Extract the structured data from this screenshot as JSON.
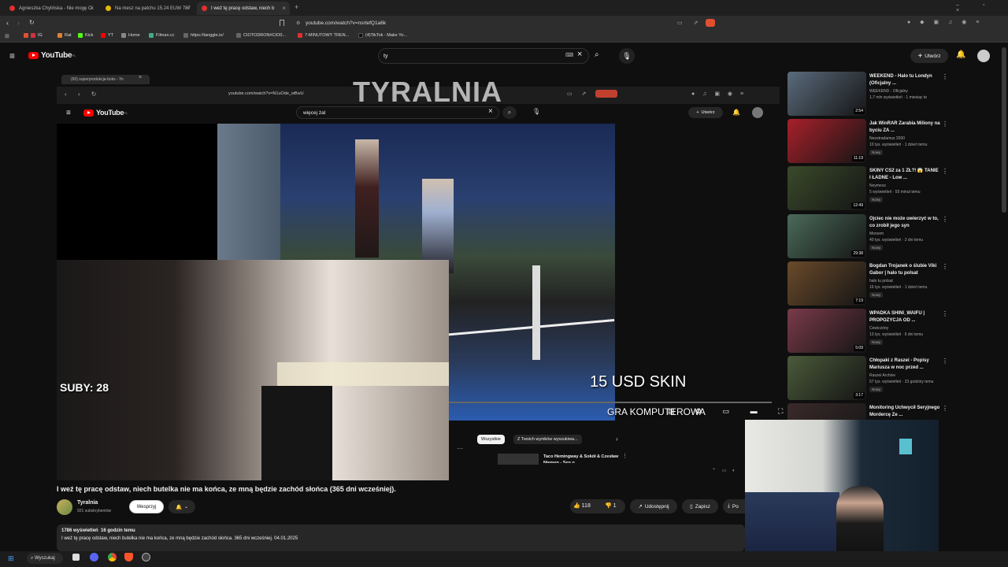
{
  "tabs": [
    {
      "label": "Agnieszka Chylińska - Nie mogę Ci"
    },
    {
      "label": "Na mesz na patchu 15.24 EUW 787"
    },
    {
      "label": "I weź tę pracę odstaw, niech b"
    }
  ],
  "address": {
    "url": "youtube.com/watch?v=nsrtefQ1a6k"
  },
  "bookmarks": [
    "IG",
    "Rat",
    "Kick",
    "YT",
    "Home",
    "Filman.cc",
    "https://tanggle.io/",
    "CIOTODRON#CIO0...",
    "7-MINUTOWY TREN...",
    "(4)TikTok - Make Yo..."
  ],
  "header": {
    "logo": "YouTube",
    "region": "PL",
    "search_value": "ty",
    "create_label": "Utwórz"
  },
  "inner": {
    "tab_label": "(60) superprodukcja-boks - Yo",
    "url": "youtube.com/watch?v=N1uOde_wBwU",
    "logo": "YouTube",
    "region": "PL",
    "search_value": "więcej żal",
    "create_label": "Utwórz",
    "chip_all": "Wszystkie",
    "chip_search": "Z Twoich wyników wyszukiwa...",
    "rec_title": "Taco Hemingway & Sokół & Czesław Niemen - Sen o..."
  },
  "overlay": {
    "channel_title": "TYRALNIA",
    "subs": "SUBY: 28",
    "skin": "15 USD SKIN",
    "gra": "GRA KOMPUTEROWA"
  },
  "video": {
    "title": "I weź tę pracę odstaw, niech butelka nie ma końca, ze mną będzie zachód słońca (365 dni wcześniej).",
    "channel": "Tyralnia",
    "subscribers": "921 subskrybentów",
    "support": "Wesprzyj",
    "likes": "118",
    "dislikes": "1",
    "share": "Udostępnij",
    "save": "Zapisz",
    "download": "Po",
    "views": "1786 wyświetleń",
    "ago": "16 godzin temu",
    "description": "I weź tę pracę odstaw, niech butelka nie ma końca, ze mną będzie zachód słońca. 365 dni wcześniej. 04.01.2025"
  },
  "recommendations": [
    {
      "title": "WEEKEND - Halo tu Londyn (Oficjalny ...",
      "channel": "WEEKEND - Oficjalny",
      "meta": "1,7 mln wyświetleń · 1 miesiąc te",
      "badge": "",
      "duration": "2:54",
      "color": "#5a6b7c"
    },
    {
      "title": "Jak WinRAR Zarabia Miliony na byciu ZA ...",
      "channel": "Neostradamus 2000",
      "meta": "10 tys. wyświetleń · 1 dzień temu",
      "badge": "Nowy",
      "duration": "11:19",
      "color": "#a8202a"
    },
    {
      "title": "SKINY CS2 za 1 ZŁ?! 😱 TANIE I ŁADNE - Low ...",
      "channel": "Neymess",
      "meta": "5 wyświetleń · 55 minut temu",
      "badge": "Nowy",
      "duration": "12:49",
      "color": "#3a4a2a"
    },
    {
      "title": "Ojciec nie może uwierzyć w to, co zrobił jego syn",
      "channel": "Morsem",
      "meta": "40 tys. wyświetleń · 2 dni temu",
      "badge": "Nowy",
      "duration": "29:38",
      "color": "#4a6a5a"
    },
    {
      "title": "Bogdan Trojanek o ślubie Viki Gabor | halo tu polsat",
      "channel": "halo tu polsat",
      "meta": "16 tys. wyświetleń · 1 dzień temu",
      "badge": "Nowy",
      "duration": "7:19",
      "color": "#6a4a2a"
    },
    {
      "title": "WPADKA SHINI_WAIFU | PROPOZYCJA OD ...",
      "channel": "Cewiczóny",
      "meta": "13 tys. wyświetleń · 6 dni temu",
      "badge": "Nowy",
      "duration": "5:09",
      "color": "#7a3a4a"
    },
    {
      "title": "Chłopaki z Raszei - Popisy Mariusza w noc przed ...",
      "channel": "Raszei Archive",
      "meta": "57 tys. wyświetleń · 23 godziny temu",
      "badge": "Nowy",
      "duration": "3:17",
      "color": "#4a5a3a"
    },
    {
      "title": "Monitoring Uchwycił Seryjnego Mordercę Ze ...",
      "channel": "",
      "meta": "",
      "badge": "",
      "duration": "",
      "color": "#3a2a2a"
    }
  ],
  "taskbar": {
    "search": "Wyszukaj"
  }
}
